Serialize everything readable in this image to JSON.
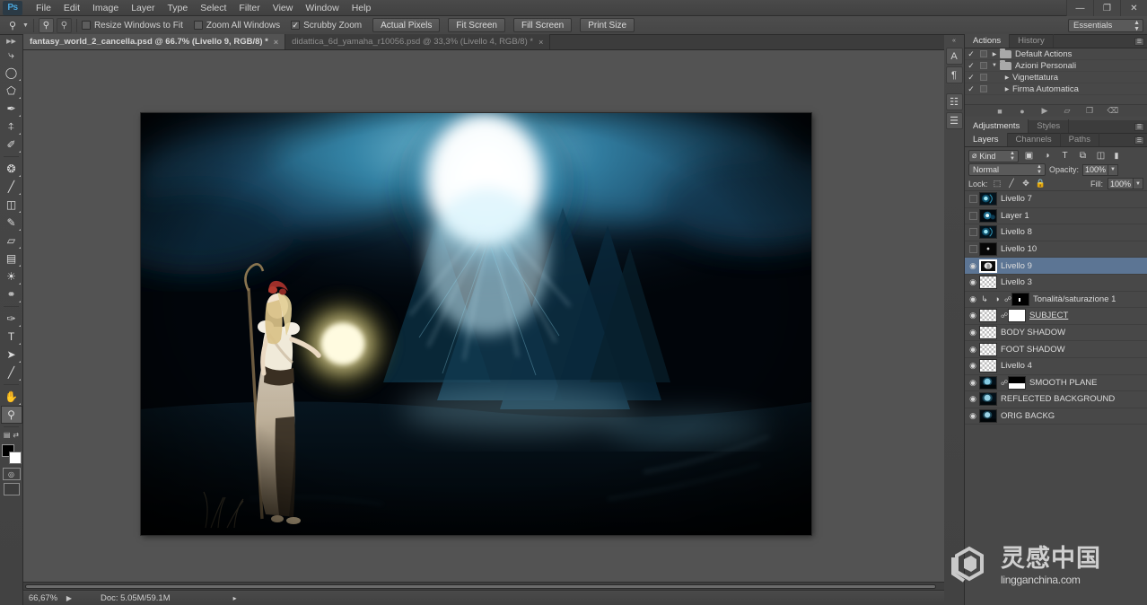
{
  "app": {
    "name": "Ps",
    "logo_color": "#49a6dc"
  },
  "menubar": {
    "items": [
      "File",
      "Edit",
      "Image",
      "Layer",
      "Type",
      "Select",
      "Filter",
      "View",
      "Window",
      "Help"
    ],
    "window_buttons": [
      {
        "name": "minimize",
        "glyph": "—"
      },
      {
        "name": "restore",
        "glyph": "❐"
      },
      {
        "name": "close",
        "glyph": "✕"
      }
    ]
  },
  "options_bar": {
    "active_tool_icon": "zoom-icon",
    "zoom_in_label": "zoom-in",
    "zoom_out_label": "zoom-out",
    "checkboxes": [
      {
        "label": "Resize Windows to Fit",
        "checked": false
      },
      {
        "label": "Zoom All Windows",
        "checked": false
      },
      {
        "label": "Scrubby Zoom",
        "checked": true
      }
    ],
    "buttons": [
      "Actual Pixels",
      "Fit Screen",
      "Fill Screen",
      "Print Size"
    ],
    "workspace": "Essentials"
  },
  "toolbar": {
    "tools": [
      {
        "name": "move-tool",
        "glyph": "☩",
        "active": false,
        "corner": false
      },
      {
        "name": "elliptical-marquee-tool",
        "glyph": "○",
        "active": false,
        "corner": true
      },
      {
        "name": "lasso-tool",
        "glyph": "⬠",
        "active": false,
        "corner": true
      },
      {
        "name": "quick-selection-tool",
        "glyph": "✒",
        "active": false,
        "corner": true
      },
      {
        "name": "crop-tool",
        "glyph": "⌗",
        "active": false,
        "corner": true
      },
      {
        "name": "eyedropper-tool",
        "glyph": "✐",
        "active": false,
        "corner": true
      },
      {
        "name": "spot-healing-brush-tool",
        "glyph": "❂",
        "active": false,
        "corner": true
      },
      {
        "name": "brush-tool",
        "glyph": "∕",
        "active": false,
        "corner": true
      },
      {
        "name": "clone-stamp-tool",
        "glyph": "⚓",
        "active": false,
        "corner": true
      },
      {
        "name": "history-brush-tool",
        "glyph": "✎",
        "active": false,
        "corner": true
      },
      {
        "name": "eraser-tool",
        "glyph": "▱",
        "active": false,
        "corner": true
      },
      {
        "name": "gradient-tool",
        "glyph": "▤",
        "active": false,
        "corner": true
      },
      {
        "name": "blur-tool",
        "glyph": "●",
        "active": false,
        "corner": true
      },
      {
        "name": "dodge-tool",
        "glyph": "⚲",
        "active": false,
        "corner": true
      },
      {
        "name": "pen-tool",
        "glyph": "✑",
        "active": false,
        "corner": true
      },
      {
        "name": "horizontal-type-tool",
        "glyph": "T",
        "active": false,
        "corner": true
      },
      {
        "name": "path-selection-tool",
        "glyph": "➤",
        "active": false,
        "corner": true
      },
      {
        "name": "rectangle-tool",
        "glyph": "╱",
        "active": false,
        "corner": true
      },
      {
        "name": "hand-tool",
        "glyph": "✋",
        "active": false,
        "corner": true
      },
      {
        "name": "zoom-tool",
        "glyph": "⌕",
        "active": true,
        "corner": false
      }
    ],
    "foreground_color": "#000000",
    "background_color": "#ffffff",
    "quick_mask_name": "quick-mask-mode",
    "screen_mode_name": "screen-mode"
  },
  "document_tabs": [
    {
      "label": "fantasy_world_2_cancella.psd @ 66.7% (Livello 9, RGB/8) *",
      "active": true,
      "close": "×"
    },
    {
      "label": "didattica_6d_yamaha_r10056.psd @ 33,3% (Livello 4, RGB/8) *",
      "active": false,
      "close": "×"
    }
  ],
  "status_bar": {
    "zoom": "66,67%",
    "doc_info": "Doc: 5.05M/59.1M",
    "arrow_glyph": "▶",
    "pointer_glyph": "▸"
  },
  "right_rail": {
    "collapse_glyph": "«",
    "icons": [
      {
        "name": "character-panel-icon",
        "glyph": "A"
      },
      {
        "name": "paragraph-panel-icon",
        "glyph": "¶"
      },
      {
        "name": "layer-comps-panel-icon",
        "glyph": "☷"
      },
      {
        "name": "notes-panel-icon",
        "glyph": "☰"
      }
    ]
  },
  "actions_panel": {
    "tabs": [
      {
        "label": "Actions",
        "active": true
      },
      {
        "label": "History",
        "active": false
      }
    ],
    "rows": [
      {
        "label": "Default Actions",
        "checked": true,
        "has_box": true,
        "expanded": false,
        "is_folder": true,
        "indent": 0
      },
      {
        "label": "Azioni Personali",
        "checked": true,
        "has_box": true,
        "expanded": true,
        "is_folder": true,
        "indent": 0
      },
      {
        "label": "Vignettatura",
        "checked": true,
        "has_box": true,
        "expanded": false,
        "is_folder": false,
        "indent": 1
      },
      {
        "label": "Firma Automatica",
        "checked": true,
        "has_box": true,
        "expanded": false,
        "is_folder": false,
        "indent": 1
      }
    ],
    "footer_icons": [
      {
        "name": "stop-playing-button",
        "glyph": "■"
      },
      {
        "name": "begin-recording-button",
        "glyph": "●"
      },
      {
        "name": "play-selection-button",
        "glyph": "▶"
      },
      {
        "name": "create-new-set-button",
        "glyph": "▱"
      },
      {
        "name": "create-new-action-button",
        "glyph": "❐"
      },
      {
        "name": "delete-button",
        "glyph": "Ὕ1"
      }
    ]
  },
  "adjustments_panel": {
    "tabs": [
      {
        "label": "Adjustments",
        "active": true
      },
      {
        "label": "Styles",
        "active": false
      }
    ]
  },
  "layers_panel": {
    "tabs": [
      {
        "label": "Layers",
        "active": true
      },
      {
        "label": "Channels",
        "active": false
      },
      {
        "label": "Paths",
        "active": false
      }
    ],
    "filter": {
      "kind_label": "Kind",
      "kind_icon": "⊘",
      "filter_icons": [
        {
          "name": "filter-pixel-icon",
          "glyph": "▣"
        },
        {
          "name": "filter-adjustment-icon",
          "glyph": "◑"
        },
        {
          "name": "filter-type-icon",
          "glyph": "T"
        },
        {
          "name": "filter-shape-icon",
          "glyph": "⧉"
        },
        {
          "name": "filter-smart-object-icon",
          "glyph": "◫"
        }
      ],
      "toggle_glyph": "▮"
    },
    "blend_mode": "Normal",
    "opacity_label": "Opacity:",
    "opacity_value": "100%",
    "lock_label": "Lock:",
    "lock_icons": [
      {
        "name": "lock-transparent-pixels-icon",
        "glyph": "⬚"
      },
      {
        "name": "lock-image-pixels-icon",
        "glyph": "∕"
      },
      {
        "name": "lock-position-icon",
        "glyph": "✥"
      },
      {
        "name": "lock-all-icon",
        "glyph": "ὑ2"
      }
    ],
    "fill_label": "Fill:",
    "fill_value": "100%",
    "layers": [
      {
        "name": "Livello 7",
        "visible": false,
        "selected": false,
        "thumb": "glow-ring",
        "mask": null,
        "link": false,
        "underline": false
      },
      {
        "name": "Layer 1",
        "visible": false,
        "selected": false,
        "thumb": "glow-burst",
        "mask": null,
        "link": false,
        "underline": false
      },
      {
        "name": "Livello 8",
        "visible": false,
        "selected": false,
        "thumb": "glow-ring",
        "mask": null,
        "link": false,
        "underline": false
      },
      {
        "name": "Livello 10",
        "visible": false,
        "selected": false,
        "thumb": "dark-dot",
        "mask": null,
        "link": false,
        "underline": false
      },
      {
        "name": "Livello 9",
        "visible": true,
        "selected": true,
        "thumb": "hand-paint",
        "mask": null,
        "link": false,
        "underline": false
      },
      {
        "name": "Livello 3",
        "visible": true,
        "selected": false,
        "thumb": "transparent",
        "mask": null,
        "link": false,
        "underline": false
      },
      {
        "name": "Tonalità/saturazione 1",
        "visible": true,
        "selected": false,
        "thumb": "adjustment",
        "mask": "black-dot",
        "link": true,
        "underline": false
      },
      {
        "name": "SUBJECT",
        "visible": true,
        "selected": false,
        "thumb": "transparent-thin",
        "mask": "white",
        "link": true,
        "underline": true
      },
      {
        "name": "BODY SHADOW",
        "visible": true,
        "selected": false,
        "thumb": "transparent",
        "mask": null,
        "link": false,
        "underline": false
      },
      {
        "name": "FOOT SHADOW",
        "visible": true,
        "selected": false,
        "thumb": "transparent",
        "mask": null,
        "link": false,
        "underline": false
      },
      {
        "name": "Livello 4",
        "visible": true,
        "selected": false,
        "thumb": "transparent",
        "mask": null,
        "link": false,
        "underline": false
      },
      {
        "name": "SMOOTH PLANE",
        "visible": true,
        "selected": false,
        "thumb": "scene",
        "mask": "split",
        "link": true,
        "underline": false
      },
      {
        "name": "REFLECTED BACKGROUND",
        "visible": true,
        "selected": false,
        "thumb": "scene",
        "mask": null,
        "link": false,
        "underline": false
      },
      {
        "name": "ORIG BACKG",
        "visible": true,
        "selected": false,
        "thumb": "scene",
        "mask": null,
        "link": false,
        "underline": false
      }
    ],
    "eye_glyph": "◉"
  },
  "canvas": {
    "artwork_title": "fantasy world composite",
    "artwork_description": "Dark fantasy scene: woman with staff holding a glowing orb beside a bright blue energy burst"
  },
  "watermark": {
    "chinese": "灵感中国",
    "latin": "lingganchina",
    "tld": ".com"
  },
  "colors": {
    "chrome": "#474747",
    "panel": "#484848",
    "selection": "#5c7594",
    "accent": "#49a6dc",
    "canvas_backdrop": "#535353"
  }
}
